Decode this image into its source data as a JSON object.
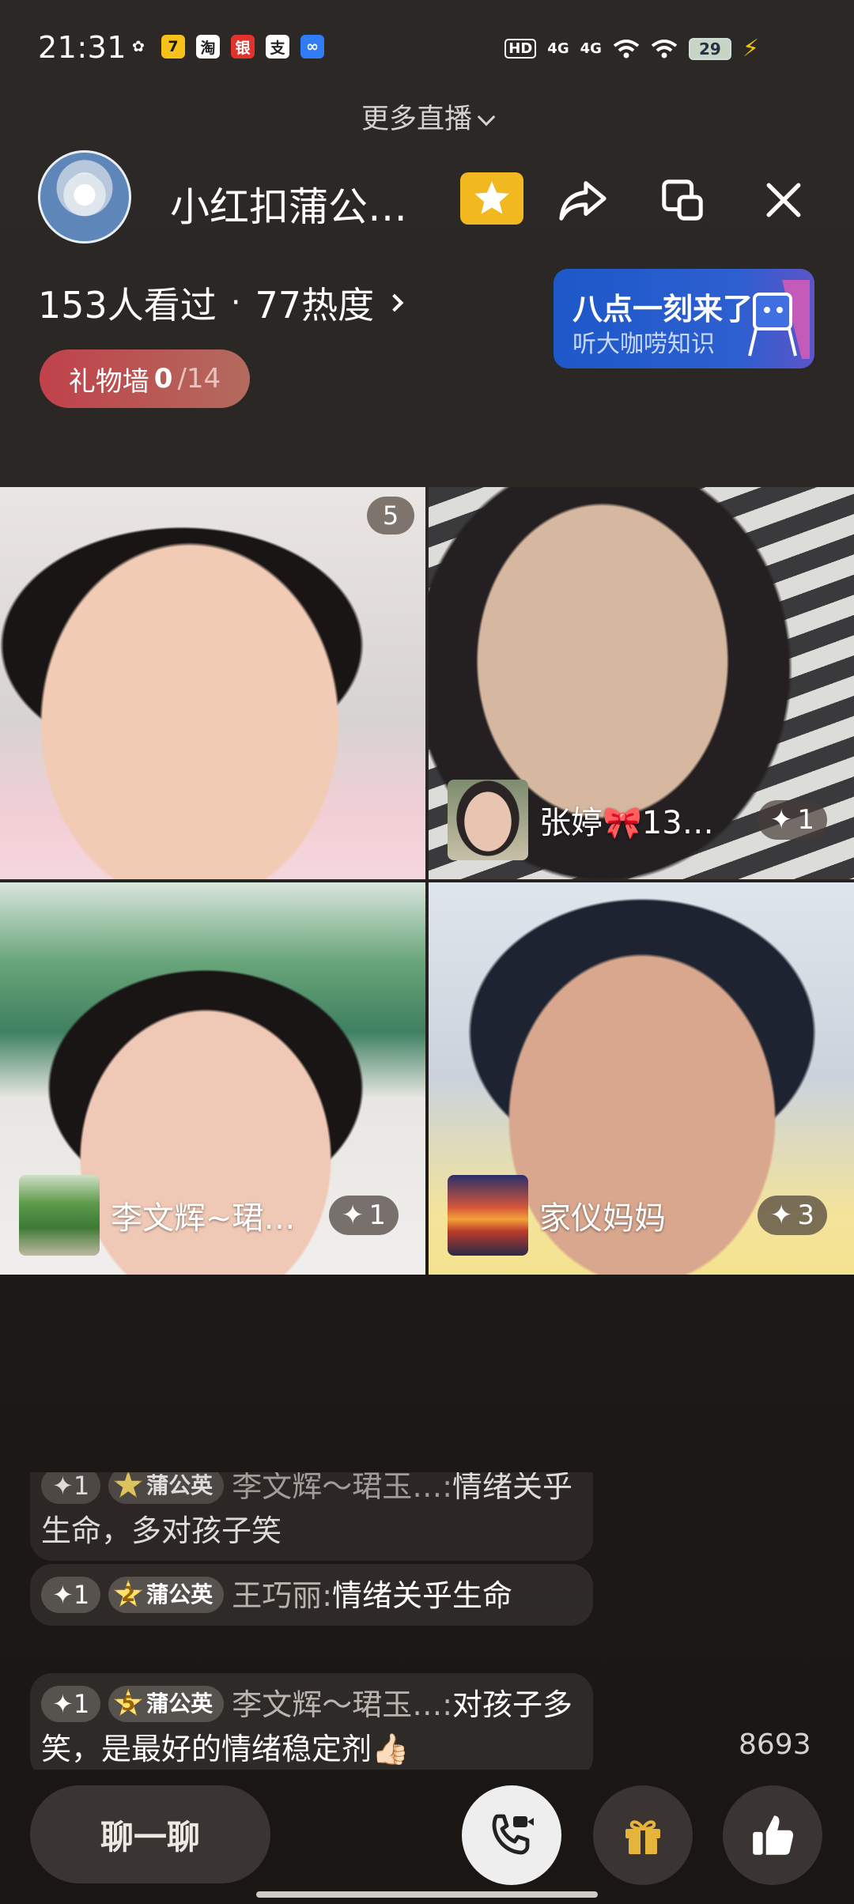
{
  "status_bar": {
    "time": "21:31",
    "app_icons": [
      {
        "name": "wechat-icon",
        "glyph": "✿",
        "bg": "#2a2624",
        "color": "#ffffff"
      },
      {
        "name": "app-7-icon",
        "glyph": "7",
        "bg": "#f6c21a",
        "color": "#1a1a1a"
      },
      {
        "name": "taobao-icon",
        "glyph": "淘",
        "bg": "#ffffff",
        "color": "#222222"
      },
      {
        "name": "bank-icon",
        "glyph": "银",
        "bg": "#e1322b",
        "color": "#ffffff"
      },
      {
        "name": "alipay-icon",
        "glyph": "支",
        "bg": "#ffffff",
        "color": "#222222"
      },
      {
        "name": "app-blue-icon",
        "glyph": "∞",
        "bg": "#2f7cf6",
        "color": "#ffffff"
      }
    ],
    "hd_label": "HD",
    "signal_1": "4G",
    "signal_2": "4G",
    "battery": "29"
  },
  "header": {
    "more_live": "更多直播",
    "host_name": "小红扣蒲公英情绪心理",
    "views": "153人看过",
    "heat": "77热度",
    "promo_title": "八点一刻来了",
    "promo_sub": "听大咖唠知识",
    "gift_wall_label": "礼物墙",
    "gift_wall_current": "0",
    "gift_wall_total": "/14"
  },
  "tiles": {
    "tile1": {
      "count": "5"
    },
    "tile2": {
      "name": "张婷🎀13…",
      "badge": "1"
    },
    "tile3": {
      "name": "李文辉~珺…",
      "badge": "1"
    },
    "tile4": {
      "name": "家仪妈妈",
      "badge": "3"
    }
  },
  "chat": {
    "messages": [
      {
        "badge": "1",
        "level": "",
        "fans": "蒲公英",
        "user": "李文辉～珺玉…:",
        "text": "情绪关乎生命，多对孩子笑"
      },
      {
        "badge": "1",
        "level": "2",
        "fans": "蒲公英",
        "user": "王巧丽:",
        "text": "情绪关乎生命"
      },
      {
        "badge": "1",
        "level": "5",
        "fans": "蒲公英",
        "user": "李文辉～珺玉…:",
        "text": "对孩子多笑，是最好的情绪稳定剂👍🏻"
      }
    ]
  },
  "likes_count": "8693",
  "bottom": {
    "chat_label": "聊一聊"
  },
  "colors": {
    "gift_wall_start": "#c0414a",
    "promo_bg": "#1d58c9",
    "star_btn": "#f2b820"
  }
}
